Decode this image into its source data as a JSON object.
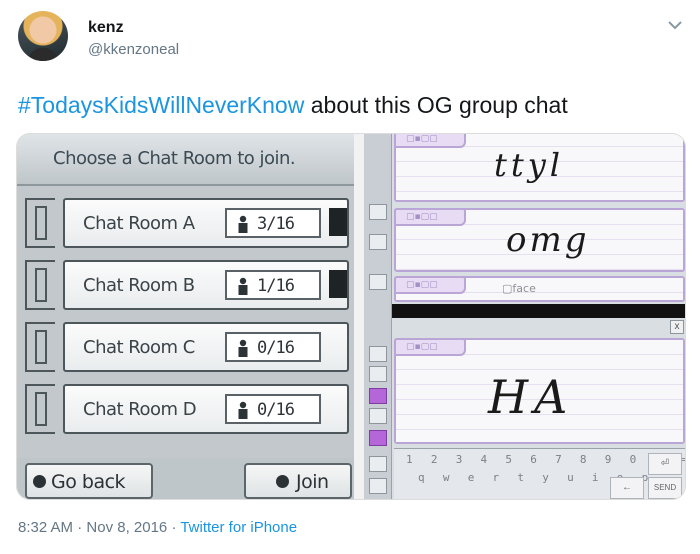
{
  "tweet": {
    "user_name": "kenz",
    "user_handle": "@kkenzoneal",
    "hashtag": "#TodaysKidsWillNeverKnow",
    "text_rest": " about this OG group chat",
    "time": "8:32 AM",
    "separator": " · ",
    "date": "Nov 8, 2016",
    "source": "Twitter for iPhone",
    "menu_icon": "chevron-down-icon",
    "colors": {
      "link": "#1b95e0",
      "secondary": "#657786",
      "text": "#14171a"
    }
  },
  "media": {
    "left_screen": {
      "title": "Choose a Chat Room to join.",
      "rooms": [
        {
          "name": "Chat Room A",
          "count": "3/16"
        },
        {
          "name": "Chat Room B",
          "count": "1/16"
        },
        {
          "name": "Chat Room C",
          "count": "0/16"
        },
        {
          "name": "Chat Room D",
          "count": "0/16"
        }
      ],
      "back_label": "Go back",
      "join_label": "Join"
    },
    "right_screen": {
      "messages": [
        {
          "handwriting": "ttyl"
        },
        {
          "handwriting": "omg"
        },
        {
          "handwriting": "HA"
        }
      ],
      "face_label": "face",
      "close_label": "x",
      "keyboard_row1": "1 2 3 4 5 6 7 8 9 0 - =",
      "keyboard_row2": "q w e r t y u i o p",
      "send_label": "SEND"
    }
  }
}
